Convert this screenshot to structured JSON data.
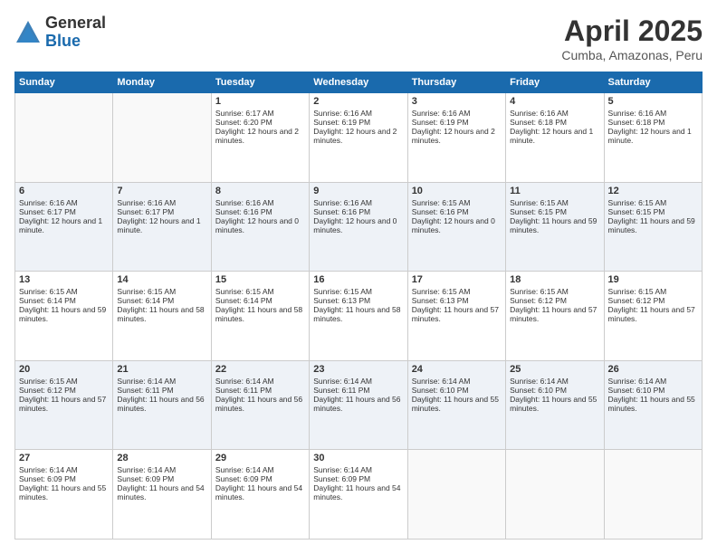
{
  "logo": {
    "general": "General",
    "blue": "Blue"
  },
  "title": "April 2025",
  "location": "Cumba, Amazonas, Peru",
  "weekdays": [
    "Sunday",
    "Monday",
    "Tuesday",
    "Wednesday",
    "Thursday",
    "Friday",
    "Saturday"
  ],
  "weeks": [
    [
      {
        "day": "",
        "empty": true
      },
      {
        "day": "",
        "empty": true
      },
      {
        "day": "1",
        "sunrise": "Sunrise: 6:17 AM",
        "sunset": "Sunset: 6:20 PM",
        "daylight": "Daylight: 12 hours and 2 minutes."
      },
      {
        "day": "2",
        "sunrise": "Sunrise: 6:16 AM",
        "sunset": "Sunset: 6:19 PM",
        "daylight": "Daylight: 12 hours and 2 minutes."
      },
      {
        "day": "3",
        "sunrise": "Sunrise: 6:16 AM",
        "sunset": "Sunset: 6:19 PM",
        "daylight": "Daylight: 12 hours and 2 minutes."
      },
      {
        "day": "4",
        "sunrise": "Sunrise: 6:16 AM",
        "sunset": "Sunset: 6:18 PM",
        "daylight": "Daylight: 12 hours and 1 minute."
      },
      {
        "day": "5",
        "sunrise": "Sunrise: 6:16 AM",
        "sunset": "Sunset: 6:18 PM",
        "daylight": "Daylight: 12 hours and 1 minute."
      }
    ],
    [
      {
        "day": "6",
        "sunrise": "Sunrise: 6:16 AM",
        "sunset": "Sunset: 6:17 PM",
        "daylight": "Daylight: 12 hours and 1 minute."
      },
      {
        "day": "7",
        "sunrise": "Sunrise: 6:16 AM",
        "sunset": "Sunset: 6:17 PM",
        "daylight": "Daylight: 12 hours and 1 minute."
      },
      {
        "day": "8",
        "sunrise": "Sunrise: 6:16 AM",
        "sunset": "Sunset: 6:16 PM",
        "daylight": "Daylight: 12 hours and 0 minutes."
      },
      {
        "day": "9",
        "sunrise": "Sunrise: 6:16 AM",
        "sunset": "Sunset: 6:16 PM",
        "daylight": "Daylight: 12 hours and 0 minutes."
      },
      {
        "day": "10",
        "sunrise": "Sunrise: 6:15 AM",
        "sunset": "Sunset: 6:16 PM",
        "daylight": "Daylight: 12 hours and 0 minutes."
      },
      {
        "day": "11",
        "sunrise": "Sunrise: 6:15 AM",
        "sunset": "Sunset: 6:15 PM",
        "daylight": "Daylight: 11 hours and 59 minutes."
      },
      {
        "day": "12",
        "sunrise": "Sunrise: 6:15 AM",
        "sunset": "Sunset: 6:15 PM",
        "daylight": "Daylight: 11 hours and 59 minutes."
      }
    ],
    [
      {
        "day": "13",
        "sunrise": "Sunrise: 6:15 AM",
        "sunset": "Sunset: 6:14 PM",
        "daylight": "Daylight: 11 hours and 59 minutes."
      },
      {
        "day": "14",
        "sunrise": "Sunrise: 6:15 AM",
        "sunset": "Sunset: 6:14 PM",
        "daylight": "Daylight: 11 hours and 58 minutes."
      },
      {
        "day": "15",
        "sunrise": "Sunrise: 6:15 AM",
        "sunset": "Sunset: 6:14 PM",
        "daylight": "Daylight: 11 hours and 58 minutes."
      },
      {
        "day": "16",
        "sunrise": "Sunrise: 6:15 AM",
        "sunset": "Sunset: 6:13 PM",
        "daylight": "Daylight: 11 hours and 58 minutes."
      },
      {
        "day": "17",
        "sunrise": "Sunrise: 6:15 AM",
        "sunset": "Sunset: 6:13 PM",
        "daylight": "Daylight: 11 hours and 57 minutes."
      },
      {
        "day": "18",
        "sunrise": "Sunrise: 6:15 AM",
        "sunset": "Sunset: 6:12 PM",
        "daylight": "Daylight: 11 hours and 57 minutes."
      },
      {
        "day": "19",
        "sunrise": "Sunrise: 6:15 AM",
        "sunset": "Sunset: 6:12 PM",
        "daylight": "Daylight: 11 hours and 57 minutes."
      }
    ],
    [
      {
        "day": "20",
        "sunrise": "Sunrise: 6:15 AM",
        "sunset": "Sunset: 6:12 PM",
        "daylight": "Daylight: 11 hours and 57 minutes."
      },
      {
        "day": "21",
        "sunrise": "Sunrise: 6:14 AM",
        "sunset": "Sunset: 6:11 PM",
        "daylight": "Daylight: 11 hours and 56 minutes."
      },
      {
        "day": "22",
        "sunrise": "Sunrise: 6:14 AM",
        "sunset": "Sunset: 6:11 PM",
        "daylight": "Daylight: 11 hours and 56 minutes."
      },
      {
        "day": "23",
        "sunrise": "Sunrise: 6:14 AM",
        "sunset": "Sunset: 6:11 PM",
        "daylight": "Daylight: 11 hours and 56 minutes."
      },
      {
        "day": "24",
        "sunrise": "Sunrise: 6:14 AM",
        "sunset": "Sunset: 6:10 PM",
        "daylight": "Daylight: 11 hours and 55 minutes."
      },
      {
        "day": "25",
        "sunrise": "Sunrise: 6:14 AM",
        "sunset": "Sunset: 6:10 PM",
        "daylight": "Daylight: 11 hours and 55 minutes."
      },
      {
        "day": "26",
        "sunrise": "Sunrise: 6:14 AM",
        "sunset": "Sunset: 6:10 PM",
        "daylight": "Daylight: 11 hours and 55 minutes."
      }
    ],
    [
      {
        "day": "27",
        "sunrise": "Sunrise: 6:14 AM",
        "sunset": "Sunset: 6:09 PM",
        "daylight": "Daylight: 11 hours and 55 minutes."
      },
      {
        "day": "28",
        "sunrise": "Sunrise: 6:14 AM",
        "sunset": "Sunset: 6:09 PM",
        "daylight": "Daylight: 11 hours and 54 minutes."
      },
      {
        "day": "29",
        "sunrise": "Sunrise: 6:14 AM",
        "sunset": "Sunset: 6:09 PM",
        "daylight": "Daylight: 11 hours and 54 minutes."
      },
      {
        "day": "30",
        "sunrise": "Sunrise: 6:14 AM",
        "sunset": "Sunset: 6:09 PM",
        "daylight": "Daylight: 11 hours and 54 minutes."
      },
      {
        "day": "",
        "empty": true
      },
      {
        "day": "",
        "empty": true
      },
      {
        "day": "",
        "empty": true
      }
    ]
  ]
}
